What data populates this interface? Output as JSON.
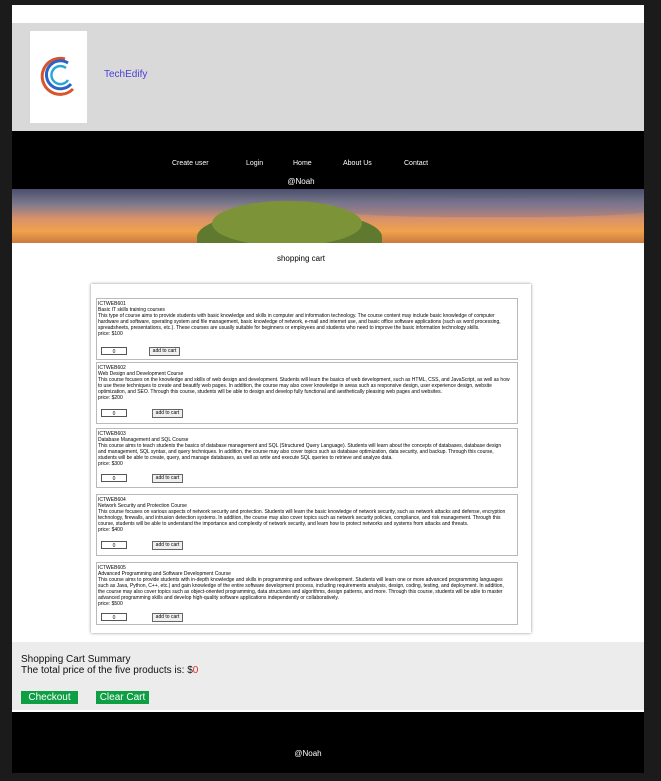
{
  "brand": {
    "name": "TechEdify"
  },
  "nav": {
    "items": [
      {
        "label": "Create user"
      },
      {
        "label": "Login"
      },
      {
        "label": "Home"
      },
      {
        "label": "About Us"
      },
      {
        "label": "Contact"
      }
    ],
    "handle": "@Noah"
  },
  "cart": {
    "title": "shopping cart",
    "products": [
      {
        "id": "ICTWEB601",
        "name": "Basic IT skills training courses",
        "description": "This type of course aims to provide students with basic knowledge and skills in computer and information technology. The course content may include basic knowledge of computer hardware and software, operating system and file management, basic knowledge of network, e-mail and internet use, and basic office software applications (such as word processing, spreadsheets, presentations, etc.). These courses are usually suitable for beginners or employees and students who need to improve the basic information technology skills.",
        "price": "price: $100",
        "qty": "0",
        "button": "add to cart"
      },
      {
        "id": "ICTWEB602",
        "name": "Web Design and Development Course",
        "description": "This course focuses on the knowledge and skills of web design and development. Students will learn the basics of web development, such as HTML, CSS, and JavaScript, as well as how to use these techniques to create and beautify web pages. In addition, the course may also cover knowledge in areas such as responsive design, user experience design, website optimization, and SEO. Through this course, students will be able to design and develop fully functional and aesthetically pleasing web pages and websites.",
        "price": "price: $200",
        "qty": "0",
        "button": "add to cart"
      },
      {
        "id": "ICTWEB603",
        "name": "Database Management and SQL Course",
        "description": "This course aims to teach students the basics of database management and SQL (Structured Query Language). Students will learn about the concepts of databases, database design and management, SQL syntax, and query techniques. In addition, the course may also cover topics such as database optimization, data security, and backup. Through this course, students will be able to create, query, and manage databases, as well as write and execute SQL queries to retrieve and analyze data.",
        "price": "price: $300",
        "qty": "0",
        "button": "add to cart"
      },
      {
        "id": "ICTWEB604",
        "name": "Network Security and Protection Course",
        "description": "This course focuses on various aspects of network security and protection. Students will learn the basic knowledge of network security, such as network attacks and defense, encryption technology, firewalls, and intrusion detection systems. In addition, the course may also cover topics such as network security policies, compliance, and risk management. Through this course, students will be able to understand the importance and complexity of network security, and learn how to protect networks and systems from attacks and threats.",
        "price": "price: $400",
        "qty": "0",
        "button": "add to cart"
      },
      {
        "id": "ICTWEB605",
        "name": "Advanced Programming and Software Development Course",
        "description": "This course aims to provide students with in-depth knowledge and skills in programming and software development. Students will learn one or more advanced programming languages such as Java, Python, C++, etc.) and gain knowledge of the entire software development process, including requirements analysis, design, coding, testing, and deployment. In addition, the course may also cover topics such as object-oriented programming, data structures and algorithms, design patterns, and more. Through this course, students will be able to master advanced programming skills and develop high-quality software applications independently or collaboratively.",
        "price": "price: $500",
        "qty": "0",
        "button": "add to cart"
      }
    ]
  },
  "summary": {
    "title": "Shopping Cart Summary",
    "total_prefix": "The total price of the five products is: $",
    "total_value": "0",
    "checkout_label": "Checkout",
    "clear_label": "Clear Cart"
  },
  "footer": {
    "text": "@Noah"
  },
  "colors": {
    "brand": "#4a3fd6",
    "header_bg": "#d9d9d9",
    "nav_bg": "#000000",
    "button_green": "#0e9f44",
    "total_value": "#e32b2b"
  }
}
